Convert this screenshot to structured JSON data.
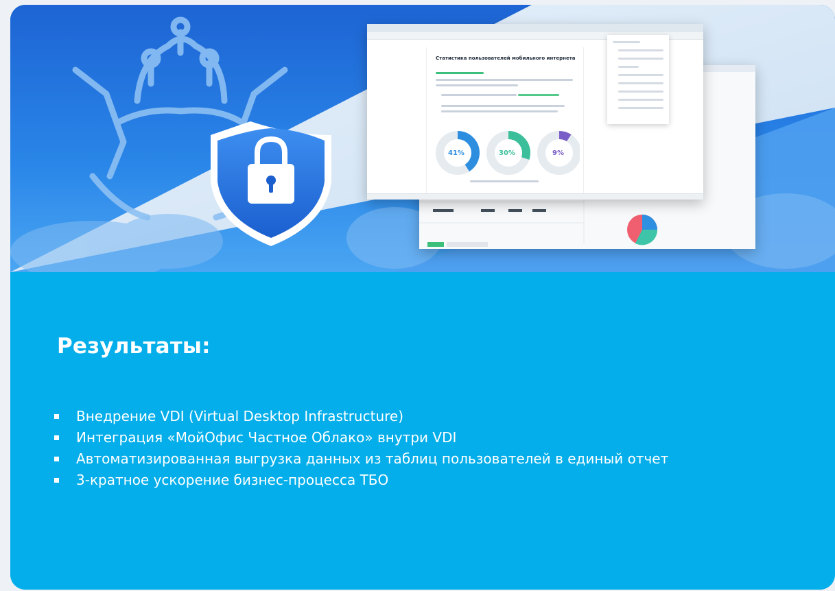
{
  "document": {
    "title": "Статистика пользователей мобильного интернета"
  },
  "stats": [
    {
      "value": "41%",
      "color": "#2d8ee0"
    },
    {
      "value": "30%",
      "color": "#3bbf9a"
    },
    {
      "value": "9%",
      "color": "#7a5ec8"
    }
  ],
  "results": {
    "heading": "Результаты:",
    "items": [
      "Внедрение VDI (Virtual Desktop Infrastructure)",
      "Интеграция «МойОфис Частное Облако» внутри VDI",
      "Автоматизированная выгрузка данных из таблиц пользователей в единый отчет",
      "3-кратное ускорение бизнес-процесса ТБО"
    ]
  },
  "colors": {
    "content_bg": "#03aeea",
    "banner_blue": "#1d64d4",
    "shield": "#2f7be0",
    "text": "#ffffff"
  },
  "icons": [
    "coat-of-arms-icon",
    "shield-lock-icon",
    "cloud-icon",
    "pie-chart-icon"
  ]
}
